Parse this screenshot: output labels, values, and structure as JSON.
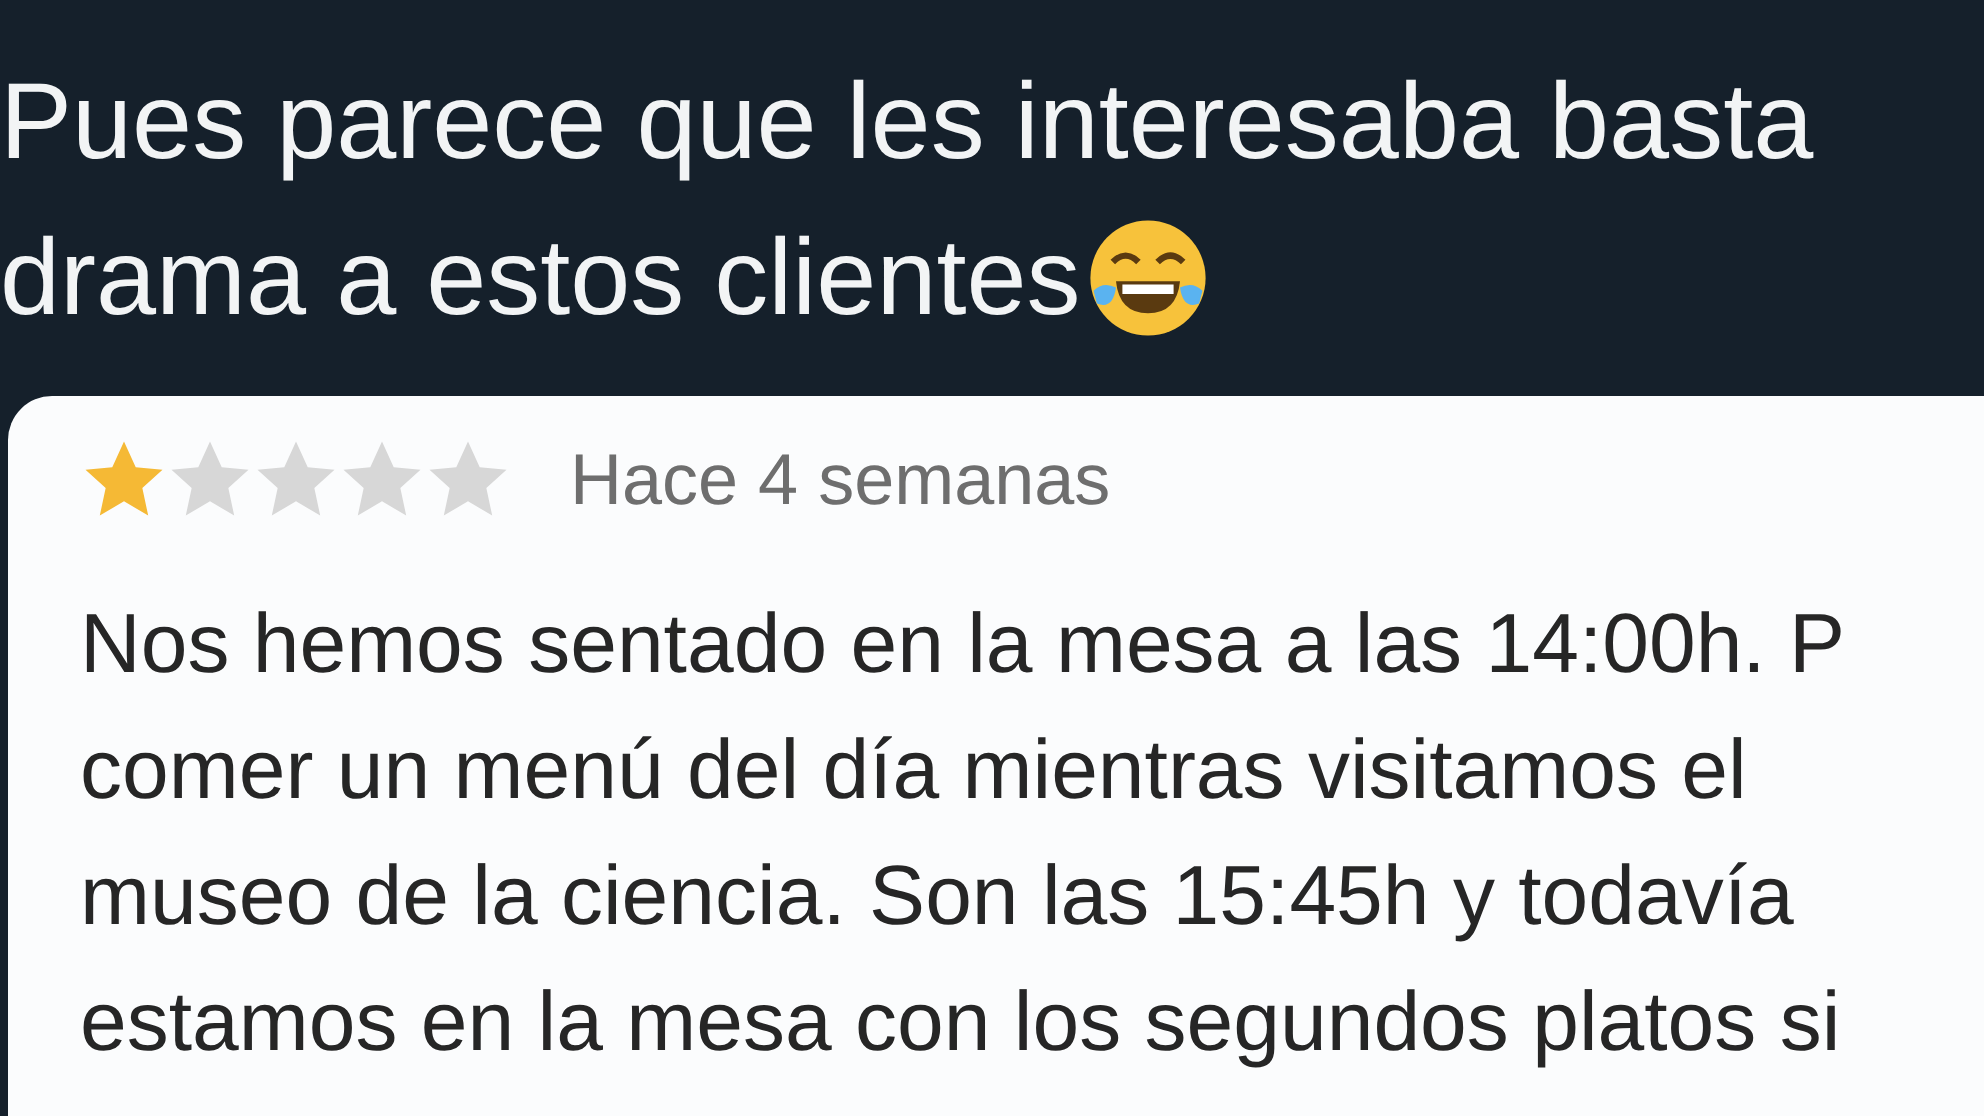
{
  "tweet": {
    "lines": [
      "Pues parece que les interesaba basta",
      "drama a estos clientes"
    ],
    "emoji": true
  },
  "review": {
    "stars": 1,
    "time": "Hace 4 semanas",
    "lines": [
      "Nos hemos sentado en la mesa a las 14:00h. P",
      "comer un menú del día mientras visitamos el",
      "museo de la ciencia. Son las 15:45h y todavía",
      "estamos en la mesa con los segundos platos si"
    ]
  }
}
